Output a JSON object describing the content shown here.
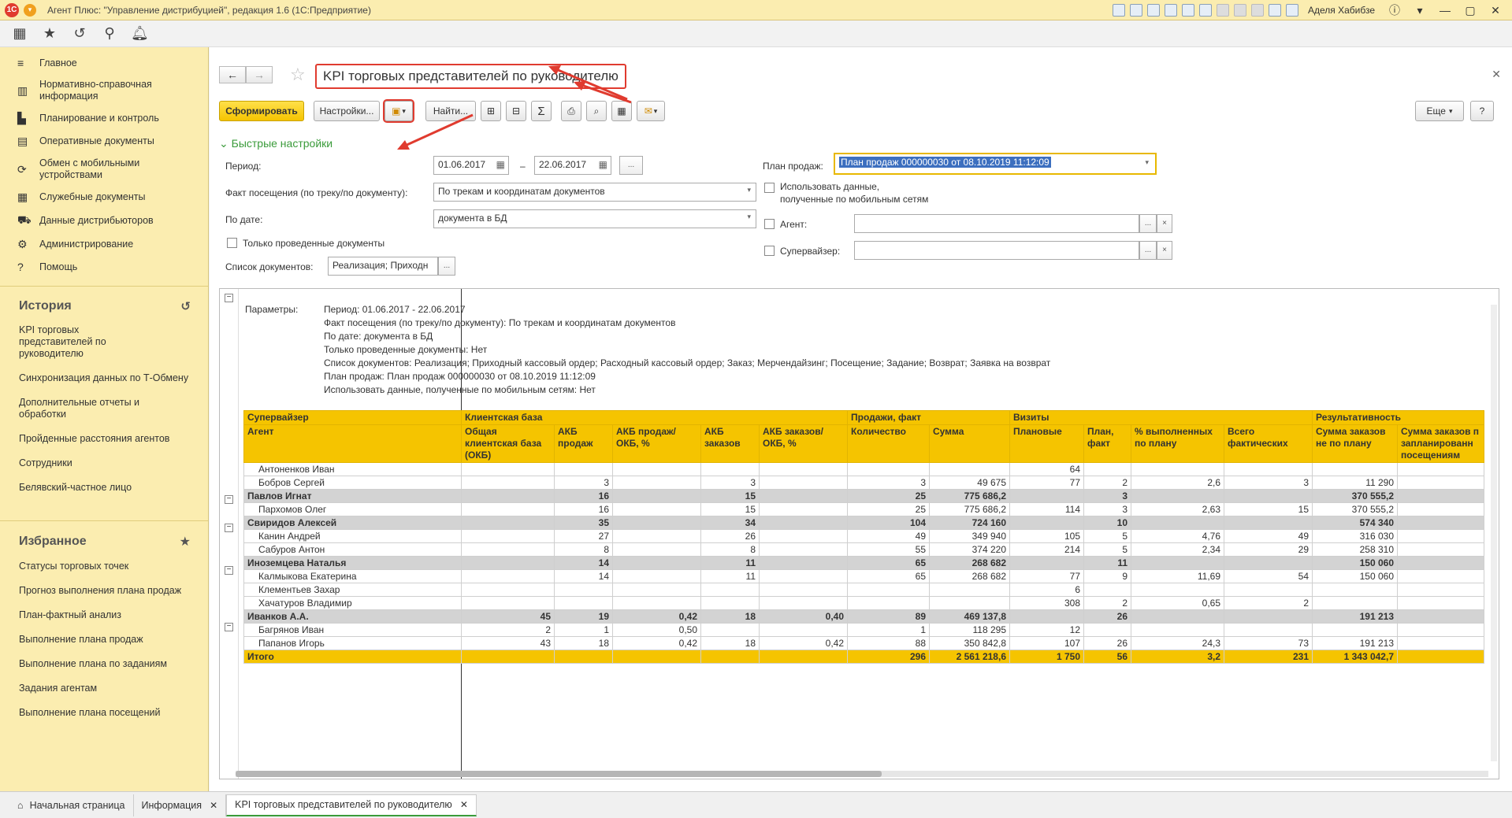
{
  "window": {
    "title": "Агент Плюс: \"Управление дистрибуцией\", редакция 1.6  (1С:Предприятие)",
    "user": "Аделя Хабибзе"
  },
  "sidebar": {
    "items": [
      {
        "label": "Главное",
        "icon": "menu-icon"
      },
      {
        "label": "Нормативно-справочная информация",
        "icon": "reference-icon"
      },
      {
        "label": "Планирование и контроль",
        "icon": "planning-icon"
      },
      {
        "label": "Оперативные документы",
        "icon": "documents-icon"
      },
      {
        "label": "Обмен с мобильными устройствами",
        "icon": "exchange-icon"
      },
      {
        "label": "Служебные документы",
        "icon": "service-docs-icon"
      },
      {
        "label": "Данные дистрибьюторов",
        "icon": "distributors-icon"
      },
      {
        "label": "Администрирование",
        "icon": "gear-icon"
      },
      {
        "label": "Помощь",
        "icon": "help-icon"
      }
    ],
    "history_title": "История",
    "history": [
      "KPI торговых представителей по руководителю",
      "Синхронизация данных по Т-Обмену",
      "Дополнительные отчеты и обработки",
      "Пройденные расстояния агентов",
      "Сотрудники",
      "Белявский-частное лицо"
    ],
    "favorites_title": "Избранное",
    "favorites": [
      "Статусы торговых точек",
      "Прогноз выполнения плана продаж",
      "План-фактный анализ",
      "Выполнение плана продаж",
      "Выполнение плана по заданиям",
      "Задания агентам",
      "Выполнение плана посещений"
    ]
  },
  "form": {
    "title": "KPI торговых представителей по руководителю",
    "btn_generate": "Сформировать",
    "btn_settings": "Настройки...",
    "btn_find": "Найти...",
    "btn_more": "Еще",
    "btn_help": "?",
    "quick_settings": "Быстрые настройки",
    "period_label": "Период:",
    "period_from": "01.06.2017",
    "period_dash": "–",
    "period_to": "22.06.2017",
    "ellipsis": "...",
    "visit_label": "Факт посещения (по треку/по документу):",
    "visit_value": "По трекам и координатам документов",
    "bydate_label": "По дате:",
    "bydate_value": "документа в БД",
    "posted_only": "Только проведенные документы",
    "doclist_label": "Список документов:",
    "doclist_value": "Реализация; Приходн",
    "plan_label": "План продаж:",
    "plan_value": "План продаж 000000030 от 08.10.2019 11:12:09",
    "mobile_data": "Использовать данные,",
    "mobile_data2": "полученные по мобильным сетям",
    "agent_label": "Агент:",
    "supervisor_label": "Супервайзер:",
    "clear": "×"
  },
  "report": {
    "params_label": "Параметры:",
    "params": [
      "Период: 01.06.2017 - 22.06.2017",
      "Факт посещения (по треку/по документу): По трекам и координатам документов",
      "По дате: документа в БД",
      "Только проведенные документы: Нет",
      "Список документов: Реализация; Приходный кассовый ордер; Расходный кассовый ордер; Заказ; Мерчендайзинг; Посещение; Задание; Возврат; Заявка на возврат",
      "План продаж: План продаж 000000030 от 08.10.2019 11:12:09",
      "Использовать данные, полученные по мобильным сетям: Нет"
    ],
    "header": {
      "g_supervisor": "Супервайзер",
      "g_agent": "Агент",
      "g_client": "Клиентская база",
      "g_sales": "Продажи, факт",
      "g_visits": "Визиты",
      "g_result": "Результативность",
      "c_okb": "Общая клиентская база (ОКБ)",
      "c_akb_sales": "АКБ продаж",
      "c_akb_sales_pct": "АКБ продаж/ОКБ, %",
      "c_akb_orders": "АКБ заказов",
      "c_akb_orders_pct": "АКБ заказов/ОКБ, %",
      "c_qty": "Количество",
      "c_sum": "Сумма",
      "c_planned": "Плановые",
      "c_plan_fact": "План, факт",
      "c_pct_done": "% выполненных по плану",
      "c_total_fact": "Всего фактических",
      "c_sum_unplanned": "Сумма заказов не по плану",
      "c_sum_planned": "Сумма заказов п запланированн посещениям"
    },
    "rows": [
      {
        "type": "agent",
        "cells": [
          "Антоненков Иван",
          "",
          "",
          "",
          "",
          "",
          "",
          "",
          "64",
          "",
          "",
          "",
          "",
          ""
        ]
      },
      {
        "type": "agent",
        "cells": [
          "Бобров Сергей",
          "",
          "3",
          "",
          "3",
          "",
          "3",
          "49 675",
          "77",
          "2",
          "2,6",
          "3",
          "11 290",
          ""
        ]
      },
      {
        "type": "sup",
        "cells": [
          "Павлов Игнат",
          "",
          "16",
          "",
          "15",
          "",
          "25",
          "775 686,2",
          "",
          "3",
          "",
          "",
          "370 555,2",
          ""
        ]
      },
      {
        "type": "agent",
        "cells": [
          "Пархомов Олег",
          "",
          "16",
          "",
          "15",
          "",
          "25",
          "775 686,2",
          "114",
          "3",
          "2,63",
          "15",
          "370 555,2",
          ""
        ]
      },
      {
        "type": "sup",
        "cells": [
          "Свиридов Алексей",
          "",
          "35",
          "",
          "34",
          "",
          "104",
          "724 160",
          "",
          "10",
          "",
          "",
          "574 340",
          ""
        ]
      },
      {
        "type": "agent",
        "cells": [
          "Канин Андрей",
          "",
          "27",
          "",
          "26",
          "",
          "49",
          "349 940",
          "105",
          "5",
          "4,76",
          "49",
          "316 030",
          ""
        ]
      },
      {
        "type": "agent",
        "cells": [
          "Сабуров Антон",
          "",
          "8",
          "",
          "8",
          "",
          "55",
          "374 220",
          "214",
          "5",
          "2,34",
          "29",
          "258 310",
          ""
        ]
      },
      {
        "type": "sup",
        "cells": [
          "Иноземцева Наталья",
          "",
          "14",
          "",
          "11",
          "",
          "65",
          "268 682",
          "",
          "11",
          "",
          "",
          "150 060",
          ""
        ]
      },
      {
        "type": "agent",
        "cells": [
          "Калмыкова Екатерина",
          "",
          "14",
          "",
          "11",
          "",
          "65",
          "268 682",
          "77",
          "9",
          "11,69",
          "54",
          "150 060",
          ""
        ]
      },
      {
        "type": "agent",
        "cells": [
          "Клементьев Захар",
          "",
          "",
          "",
          "",
          "",
          "",
          "",
          "6",
          "",
          "",
          "",
          "",
          ""
        ]
      },
      {
        "type": "agent",
        "cells": [
          "Хачатуров Владимир",
          "",
          "",
          "",
          "",
          "",
          "",
          "",
          "308",
          "2",
          "0,65",
          "2",
          "",
          ""
        ]
      },
      {
        "type": "sup",
        "cells": [
          "Иванков А.А.",
          "45",
          "19",
          "0,42",
          "18",
          "0,40",
          "89",
          "469 137,8",
          "",
          "26",
          "",
          "",
          "191 213",
          ""
        ]
      },
      {
        "type": "agent",
        "cells": [
          "Багрянов Иван",
          "2",
          "1",
          "0,50",
          "",
          "",
          "1",
          "118 295",
          "12",
          "",
          "",
          "",
          "",
          ""
        ]
      },
      {
        "type": "agent",
        "cells": [
          "Папанов Игорь",
          "43",
          "18",
          "0,42",
          "18",
          "0,42",
          "88",
          "350 842,8",
          "107",
          "26",
          "24,3",
          "73",
          "191 213",
          ""
        ]
      },
      {
        "type": "tot",
        "cells": [
          "Итого",
          "",
          "",
          "",
          "",
          "",
          "296",
          "2 561 218,6",
          "1 750",
          "56",
          "3,2",
          "231",
          "1 343 042,7",
          ""
        ]
      }
    ]
  },
  "tabs": [
    {
      "label": "Начальная страница",
      "icon": "home-icon"
    },
    {
      "label": "Информация"
    },
    {
      "label": "KPI торговых представителей по руководителю"
    }
  ],
  "colors": {
    "accent": "#f5c400",
    "sidebar": "#fbedb0",
    "annotation": "#e03b2f",
    "group": "#d3d3d3"
  }
}
